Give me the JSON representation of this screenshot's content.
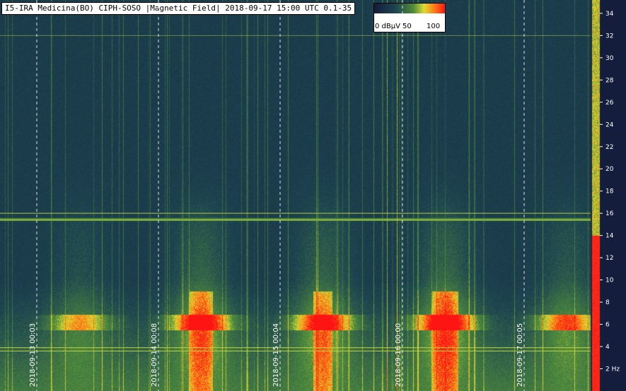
{
  "title": "I5-IRA Medicina(BO) CIPH-SOSO |Magnetic Field| 2018-09-17 15:00 UTC 0.1-35",
  "legend": {
    "labels": [
      "0 dBµV",
      "50",
      "100"
    ],
    "colors": [
      "#1e2a4a",
      "#2e6a6a",
      "#c8d040",
      "#ff2020"
    ]
  },
  "colors": {
    "background": "#1a2838",
    "low": "#1e2a4a",
    "mid": "#3a7a5a",
    "high": "#f0f040",
    "max": "#ff2020",
    "grid": "#ffffff",
    "hline": "#b8d040"
  },
  "chart_data": {
    "type": "heatmap",
    "title": "I5-IRA Medicina(BO) CIPH-SOSO |Magnetic Field| 2018-09-17 15:00 UTC 0.1-35",
    "x_ticks": [
      "2018-09-13 00:03",
      "2018-09-14 00:08",
      "2018-09-15 00:04",
      "2018-09-16 00:00",
      "2018-09-17 00:05"
    ],
    "y_ticks": [
      2,
      4,
      6,
      8,
      10,
      12,
      14,
      16,
      18,
      20,
      22,
      24,
      26,
      28,
      30,
      32,
      34
    ],
    "y_unit_label": "2 Hz",
    "ylim": [
      0.1,
      35
    ],
    "color_scale": {
      "min": 0,
      "max": 100,
      "unit": "dBµV"
    },
    "horizontal_lines_hz": [
      16,
      15.4,
      3.9,
      3.6
    ],
    "bursts": [
      {
        "day_index": 0,
        "freq_hz": 6.2,
        "intensity": 55
      },
      {
        "day_index": 1,
        "freq_hz": 6.2,
        "intensity": 95
      },
      {
        "day_index": 2,
        "freq_hz": 6.2,
        "intensity": 90
      },
      {
        "day_index": 3,
        "freq_hz": 6.2,
        "intensity": 100
      },
      {
        "day_index": 4,
        "freq_hz": 6.2,
        "intensity": 70
      }
    ]
  }
}
